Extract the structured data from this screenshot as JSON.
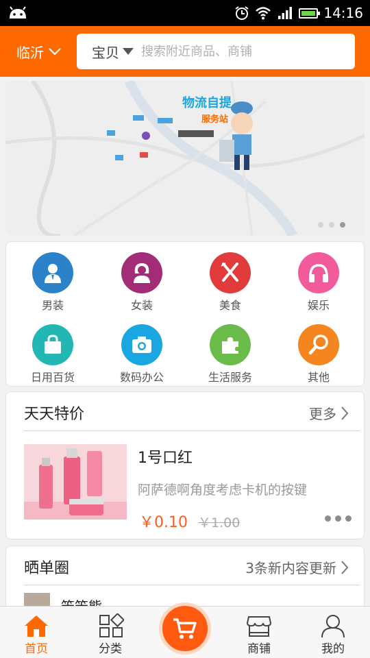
{
  "statusbar": {
    "time": "14:16"
  },
  "header": {
    "city": "临沂",
    "search_type": "宝贝",
    "search_placeholder": "搜索附近商品、商铺"
  },
  "banner": {
    "headline": "物流自提",
    "subline": "服务站"
  },
  "categories": [
    {
      "label": "男装",
      "color": "#2b82c9",
      "icon": "man-icon"
    },
    {
      "label": "女装",
      "color": "#a32c78",
      "icon": "woman-icon"
    },
    {
      "label": "美食",
      "color": "#e23b3b",
      "icon": "fork-knife-icon"
    },
    {
      "label": "娱乐",
      "color": "#f25b9b",
      "icon": "headphones-icon"
    },
    {
      "label": "日用百货",
      "color": "#22b7b4",
      "icon": "shopping-bag-icon"
    },
    {
      "label": "数码办公",
      "color": "#1aa6e0",
      "icon": "camera-icon"
    },
    {
      "label": "生活服务",
      "color": "#6bbb4a",
      "icon": "puzzle-icon"
    },
    {
      "label": "其他",
      "color": "#f5861f",
      "icon": "magnifier-icon"
    }
  ],
  "deals": {
    "title": "天天特价",
    "more": "更多",
    "item": {
      "name": "1号口红",
      "description": "阿萨德啊角度考虑卡机的按键",
      "price": "￥0.10",
      "original_price": "￥1.00"
    }
  },
  "showcase": {
    "title": "晒单圈",
    "update_text": "3条新内容更新",
    "first_user": "笨笨熊"
  },
  "nav": {
    "home": "首页",
    "category": "分类",
    "shop": "商铺",
    "mine": "我的"
  },
  "colors": {
    "accent": "#ff6a00",
    "price": "#ff5a1a"
  }
}
